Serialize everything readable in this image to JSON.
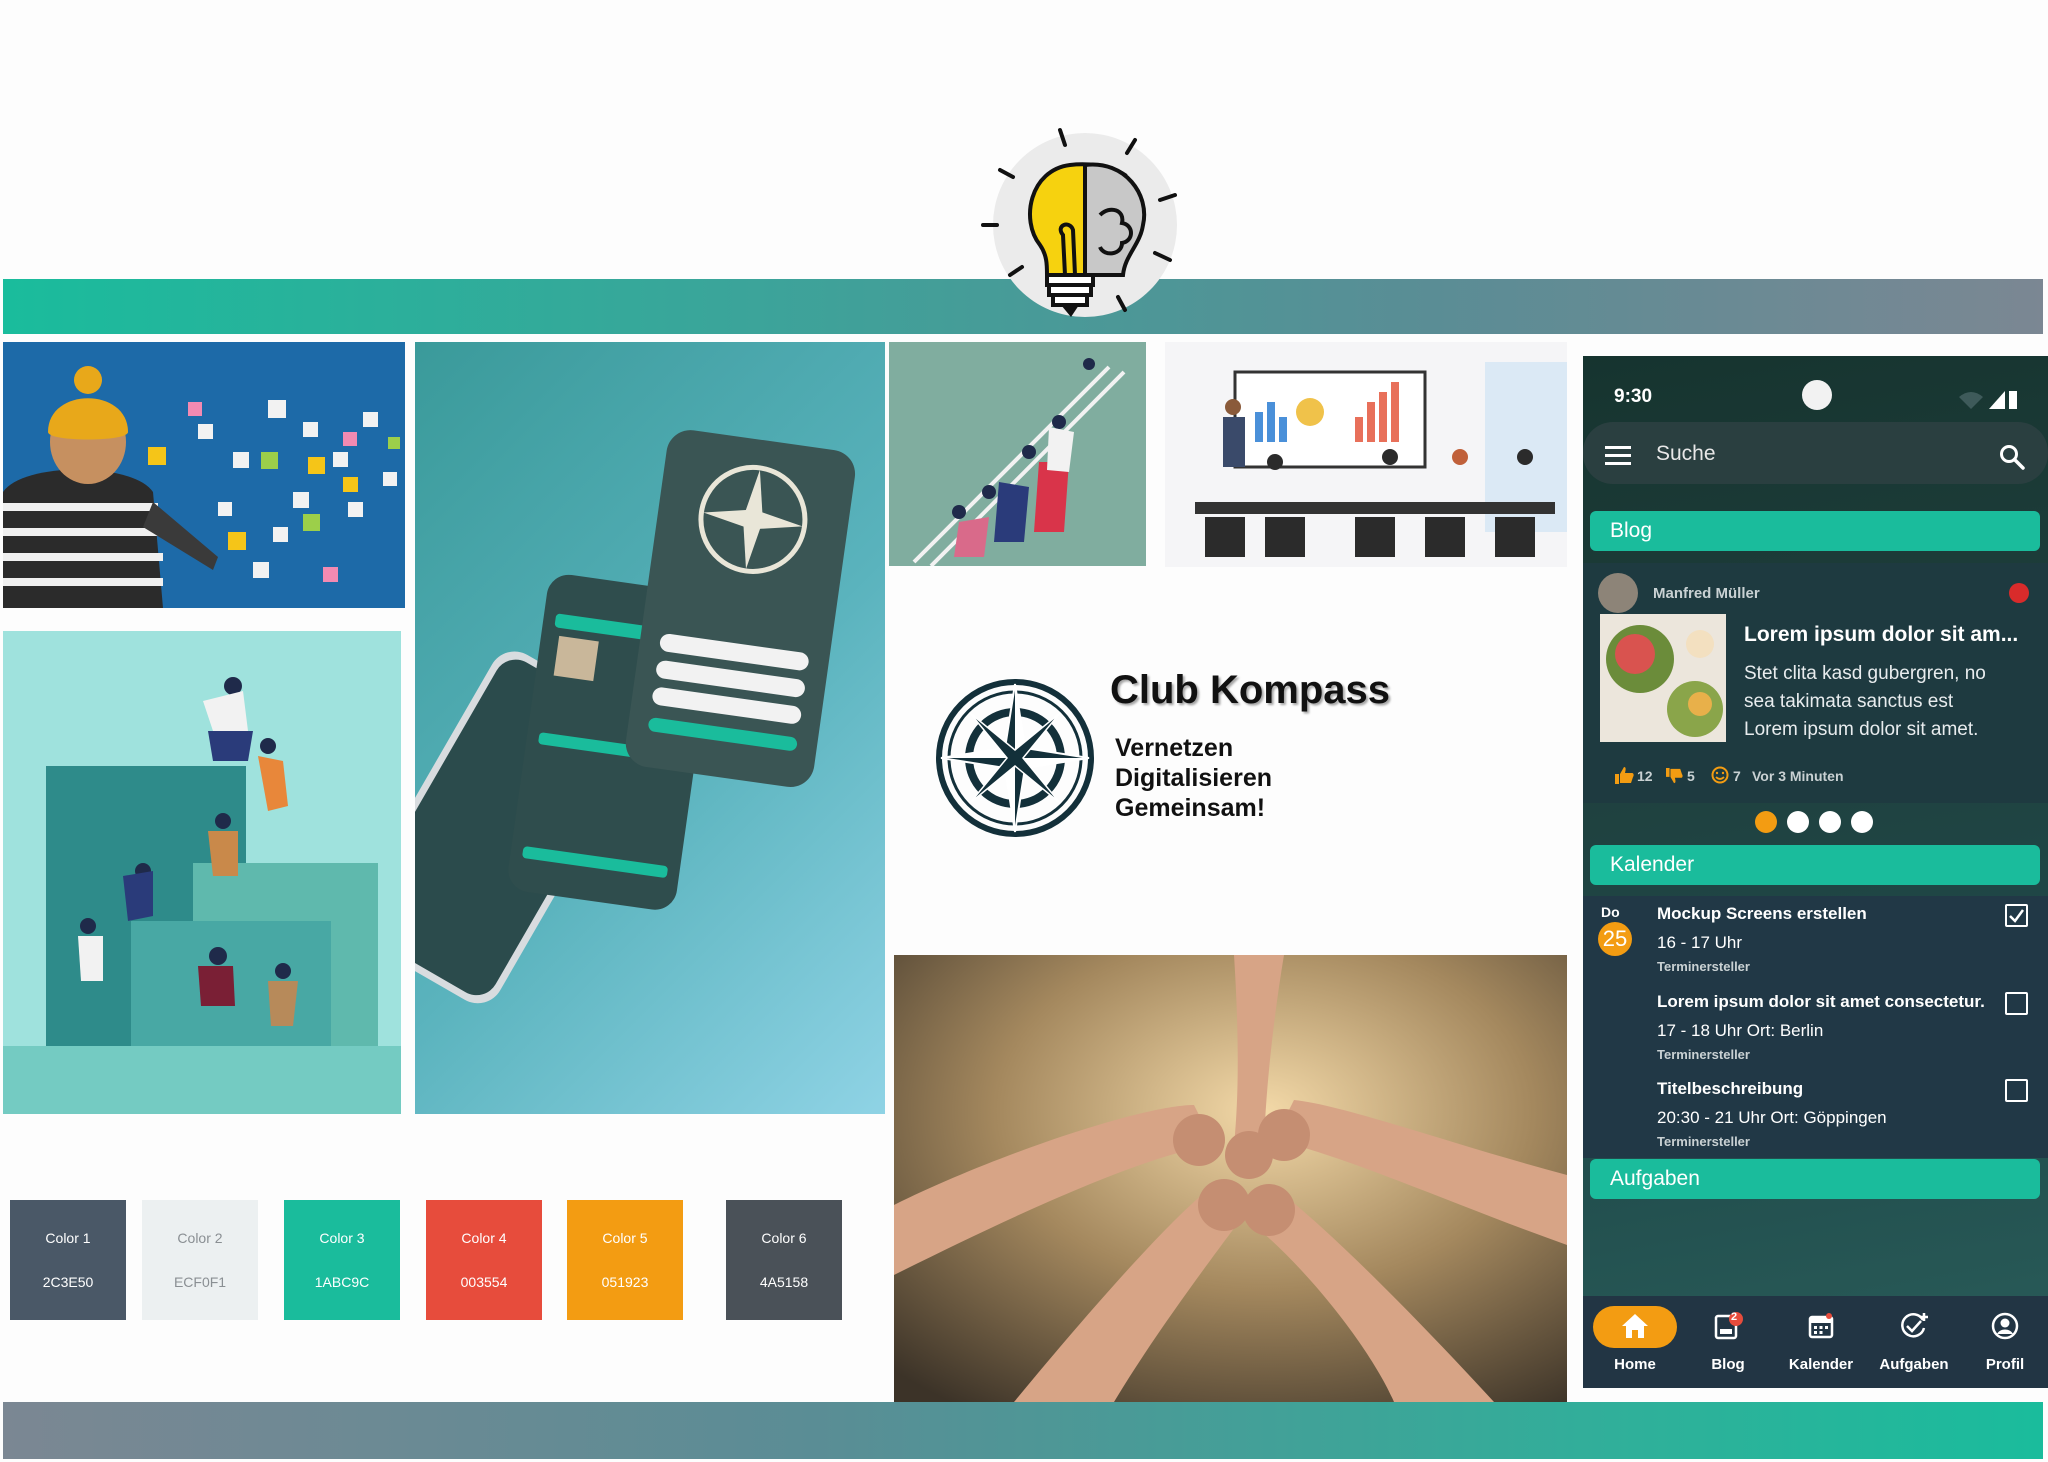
{
  "brand": {
    "title": "Club Kompass",
    "taglines": [
      "Vernetzen",
      "Digitalisieren",
      "Gemeinsam!"
    ]
  },
  "palette": [
    {
      "name": "Color 1",
      "hex": "2C3E50",
      "bg": "#4a5867",
      "fg": "#ffffff"
    },
    {
      "name": "Color 2",
      "hex": "ECF0F1",
      "bg": "#ecf0f1",
      "fg": "#8a8f93"
    },
    {
      "name": "Color 3",
      "hex": "1ABC9C",
      "bg": "#1abc9c",
      "fg": "#ffffff"
    },
    {
      "name": "Color 4",
      "hex": "003554",
      "bg": "#e74c3c",
      "fg": "#ffffff"
    },
    {
      "name": "Color 5",
      "hex": "051923",
      "bg": "#f39c12",
      "fg": "#ffffff"
    },
    {
      "name": "Color 6",
      "hex": "4A5158",
      "bg": "#4a5158",
      "fg": "#ffffff"
    }
  ],
  "phone": {
    "status_time": "9:30",
    "search_placeholder": "Suche",
    "blog_label": "Blog",
    "blog_post": {
      "author": "Manfred Müller",
      "title": "Lorem ipsum dolor sit am...",
      "body_lines": [
        "Stet clita kasd gubergren, no",
        "sea takimata sanctus est",
        "Lorem ipsum dolor sit amet."
      ],
      "likes": "12",
      "dislikes": "5",
      "reactions": "7",
      "time_ago": "Vor 3 Minuten"
    },
    "carousel": {
      "count": 4,
      "active": 0
    },
    "calendar_label": "Kalender",
    "date": {
      "weekday": "Do",
      "day": "25"
    },
    "events": [
      {
        "title": "Mockup Screens erstellen",
        "time": "16 - 17 Uhr",
        "creator": "Terminersteller",
        "checked": true
      },
      {
        "title": "Lorem ipsum dolor sit amet consectetur.",
        "time": "17 - 18 Uhr Ort: Berlin",
        "creator": "Terminersteller",
        "checked": false
      },
      {
        "title": "Titelbeschreibung",
        "time": "20:30 - 21 Uhr Ort: Göppingen",
        "creator": "Terminersteller",
        "checked": false
      }
    ],
    "tasks_label": "Aufgaben",
    "nav": [
      {
        "label": "Home",
        "icon": "home-icon",
        "badge": ""
      },
      {
        "label": "Blog",
        "icon": "blog-icon",
        "badge": "2"
      },
      {
        "label": "Kalender",
        "icon": "calendar-icon",
        "badge": ""
      },
      {
        "label": "Aufgaben",
        "icon": "tasks-icon",
        "badge": ""
      },
      {
        "label": "Profil",
        "icon": "profile-icon",
        "badge": ""
      }
    ],
    "accent": "#f39c12",
    "primary": "#1abc9c"
  }
}
